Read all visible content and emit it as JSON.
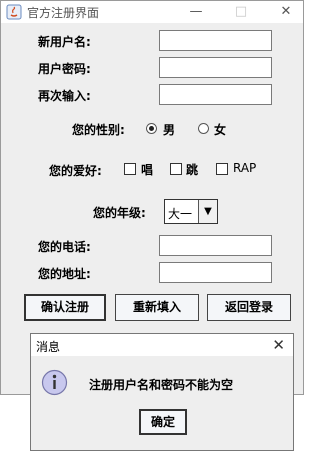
{
  "window": {
    "title": "官方注册界面",
    "minimize": "—",
    "maximize": "□",
    "close": "✕"
  },
  "form": {
    "username_label": "新用户名:",
    "password_label": "用户密码:",
    "confirm_label": "再次输入:",
    "username_value": "",
    "password_value": "",
    "confirm_value": "",
    "gender_label": "您的性别:",
    "gender_options": [
      "男",
      "女"
    ],
    "gender_selected": "男",
    "hobby_label": "您的爱好:",
    "hobby_options": [
      "唱",
      "跳",
      "RAP"
    ],
    "grade_label": "您的年级:",
    "grade_selected": "大一",
    "phone_label": "您的电话:",
    "address_label": "您的地址:",
    "phone_value": "",
    "address_value": ""
  },
  "buttons": {
    "confirm": "确认注册",
    "reset": "重新填入",
    "back": "返回登录"
  },
  "dialog": {
    "title": "消息",
    "close": "✕",
    "message": "注册用户名和密码不能为空",
    "ok": "确定",
    "icon": "info-icon"
  },
  "colors": {
    "window_bg": "#eeeeee",
    "info_icon_fill": "#c8c8ee"
  }
}
